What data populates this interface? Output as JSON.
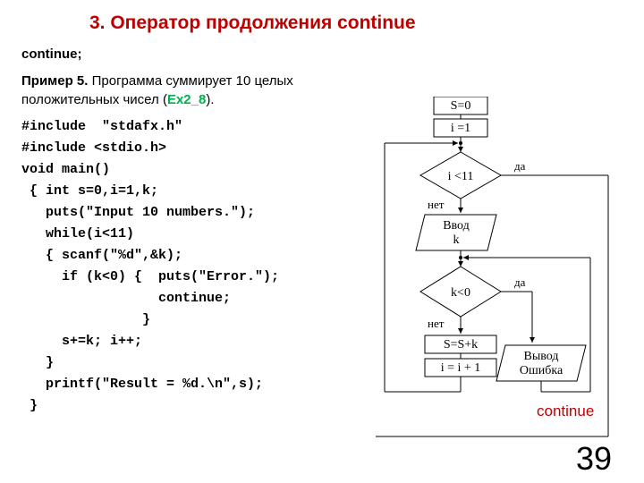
{
  "title": "3. Оператор продолжения continue",
  "syntax": "continue;",
  "example": {
    "label_bold": "Пример 5.",
    "label_text": " Программа суммирует 10 целых положительных чисел (",
    "label_green": "Ex2_8",
    "label_close": ")."
  },
  "code": {
    "l1": "#include  \"stdafx.h\"",
    "l2": "#include <stdio.h>",
    "l3": "void main()",
    "l4": " { int s=0,i=1,k;",
    "l5": "   puts(\"Input 10 numbers.\");",
    "l6": "   while(i<11)",
    "l7": "   { scanf(\"%d\",&k);",
    "l8": "     if (k<0) {  puts(\"Error.\");",
    "l9": "                 continue;",
    "l10": "               }",
    "l11": "     s+=k; i++;",
    "l12": "   }",
    "l13": "   printf(\"Result = %d.\\n\",s);",
    "l14": " }"
  },
  "flow": {
    "s0": "S=0",
    "i1": "i =1",
    "cond1": "i  <11",
    "yes": "да",
    "no": "нет",
    "input": "Ввод\nk",
    "cond2": "k<0",
    "sum": "S=S+k",
    "inc": "i =  i + 1",
    "err": "Вывод\nОшибка"
  },
  "continue_label": "continue",
  "page": "39"
}
